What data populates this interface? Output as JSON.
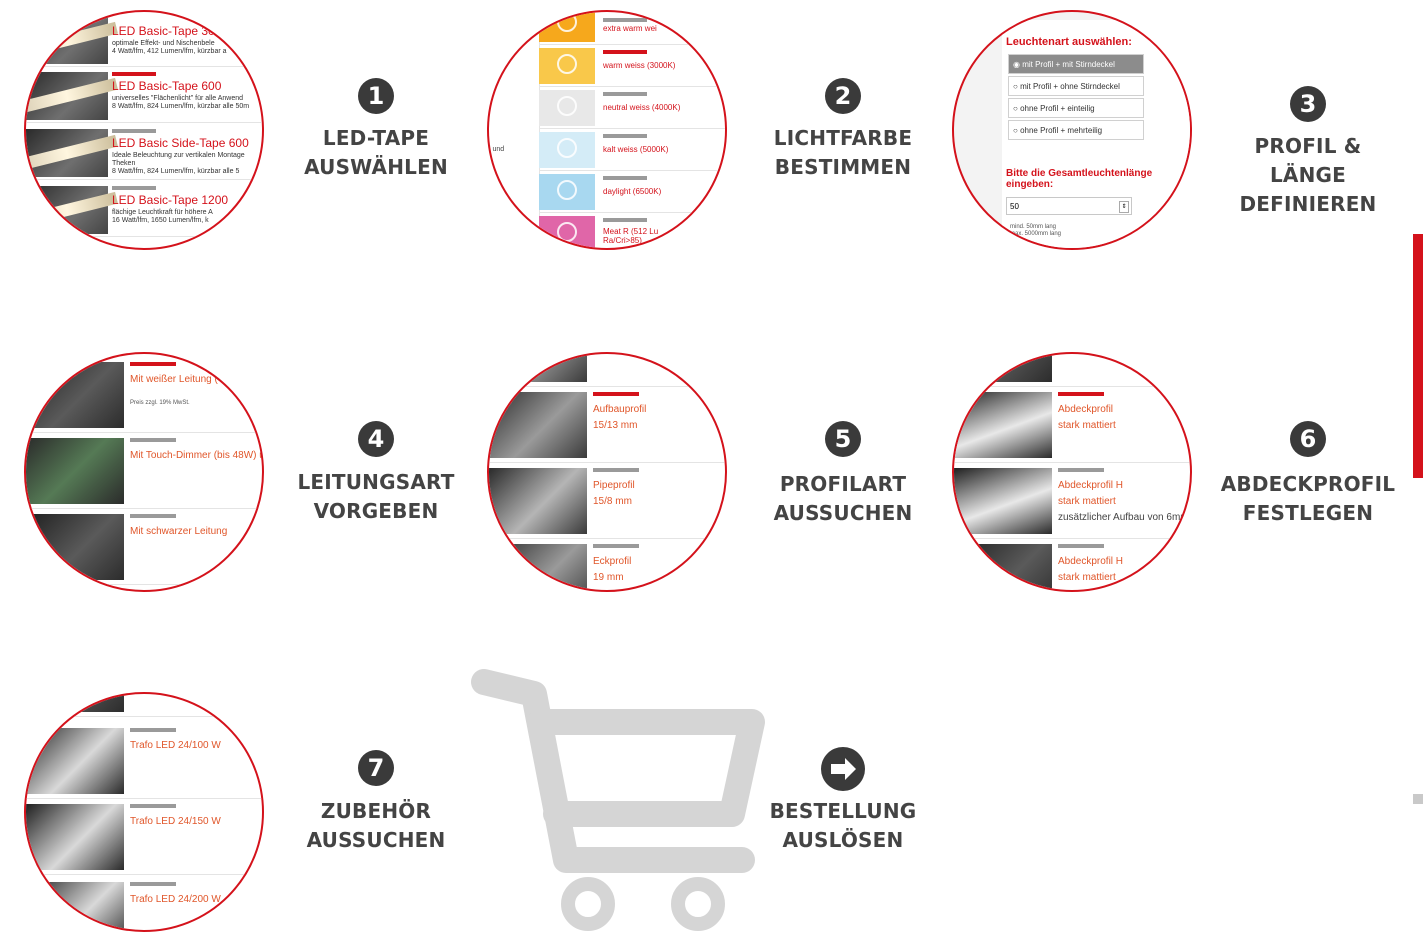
{
  "steps": [
    {
      "num": "1",
      "line1": "LED-TAPE",
      "line2": "AUSWÄHLEN"
    },
    {
      "num": "2",
      "line1": "LICHTFARBE",
      "line2": "BESTIMMEN"
    },
    {
      "num": "3",
      "line1": "PROFIL & LÄNGE",
      "line2": "DEFINIEREN"
    },
    {
      "num": "4",
      "line1": "LEITUNGSART",
      "line2": "VORGEBEN"
    },
    {
      "num": "5",
      "line1": "PROFILART",
      "line2": "AUSSUCHEN"
    },
    {
      "num": "6",
      "line1": "ABDECKPROFIL",
      "line2": "FESTLEGEN"
    },
    {
      "num": "7",
      "line1": "ZUBEHÖR",
      "line2": "AUSSUCHEN"
    }
  ],
  "order": {
    "line1": "BESTELLUNG",
    "line2": "AUSLÖSEN",
    "icon": "arrow-right-icon"
  },
  "cart": {
    "icon": "shopping-cart-icon",
    "color": "#d5d5d5"
  },
  "tapes": [
    {
      "title": "LED Basic-Tape 300",
      "desc1": "optimale Effekt- und Nischenbele",
      "desc2": "4 Watt/lfm, 412 Lumen/lfm, kürzbar a"
    },
    {
      "title": "LED Basic-Tape 600",
      "desc1": "universelles \"Flächenlicht\" für alle Anwend",
      "desc2": "8 Watt/lfm, 824 Lumen/lfm, kürzbar alle 50m"
    },
    {
      "title": "LED Basic Side-Tape 600",
      "desc1": "Ideale Beleuchtung zur vertikalen Montage",
      "desc2": "Theken",
      "desc3": "8 Watt/lfm, 824 Lumen/lfm, kürzbar alle 5"
    },
    {
      "title": "LED Basic-Tape 1200",
      "desc1": "flächige Leuchtkraft für höhere A",
      "desc2": "16 Watt/lfm, 1650 Lumen/lfm, k"
    }
  ],
  "colors": [
    {
      "label": "extra warm wei",
      "swatch": "#f6a81c"
    },
    {
      "label": "warm weiss (3000K)",
      "swatch": "#f9c84a"
    },
    {
      "label": "neutral weiss (4000K)",
      "swatch": "#e8e8e8"
    },
    {
      "label": "kalt weiss (5000K)",
      "swatch": "#d4ecf7"
    },
    {
      "label": "daylight (6500K)",
      "swatch": "#a8d8f0"
    },
    {
      "label": "Meat R (512 Lu",
      "label2": "Ra/Cri>85)",
      "swatch": "#e066a8"
    }
  ],
  "colors_side_text": "l und",
  "fixture": {
    "heading": "Leuchtenart auswählen:",
    "options": [
      "mit Profil + mit Stirndeckel",
      "mit Profil + ohne Stirndeckel",
      "ohne Profil + einteilig",
      "ohne Profil + mehrteilig"
    ],
    "length_prompt_1": "Bitte die Gesamtleuchtenlänge",
    "length_prompt_2": "eingeben:",
    "length_value": "50",
    "note_1": "mind. 50mm lang",
    "note_2": "max. 5000mm lang"
  },
  "cables": [
    {
      "title": "Mit weißer Leitung (",
      "sub": "Preis zzgl. 19% MwSt."
    },
    {
      "title": "Mit Touch-Dimmer (bis 48W) u"
    },
    {
      "title": "Mit schwarzer Leitung"
    }
  ],
  "profiles": [
    {
      "title": "Aufbauprofil",
      "size": "15/13 mm"
    },
    {
      "title": "Pipeprofil",
      "size": "15/8 mm"
    },
    {
      "title": "Eckprofil",
      "size": "19 mm"
    }
  ],
  "covers": [
    {
      "title": "Abdeckprofil",
      "sub": "stark mattiert"
    },
    {
      "title": "Abdeckprofil H",
      "sub": "stark mattiert",
      "extra": "zusätzlicher Aufbau von 6mm"
    },
    {
      "title": "Abdeckprofil H",
      "sub": "stark mattiert"
    }
  ],
  "accessories": [
    {
      "title": "Trafo LED 24/100 W"
    },
    {
      "title": "Trafo LED 24/150 W"
    },
    {
      "title": "Trafo LED 24/200 W"
    }
  ],
  "accent": "#d4121b"
}
